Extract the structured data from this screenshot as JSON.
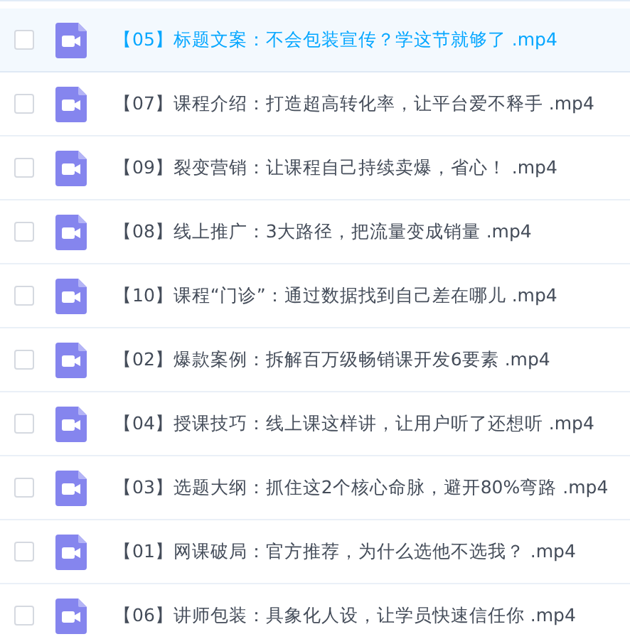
{
  "files": [
    {
      "name": "【05】标题文案：不会包装宣传？学这节就够了 .mp4",
      "selected": true,
      "checked": false
    },
    {
      "name": "【07】课程介绍：打造超高转化率，让平台爱不释手 .mp4",
      "selected": false,
      "checked": false
    },
    {
      "name": "【09】裂变营销：让课程自己持续卖爆，省心！ .mp4",
      "selected": false,
      "checked": false
    },
    {
      "name": "【08】线上推广：3大路径，把流量变成销量 .mp4",
      "selected": false,
      "checked": false
    },
    {
      "name": "【10】课程“门诊”：通过数据找到自己差在哪儿 .mp4",
      "selected": false,
      "checked": false
    },
    {
      "name": "【02】爆款案例：拆解百万级畅销课开发6要素 .mp4",
      "selected": false,
      "checked": false
    },
    {
      "name": "【04】授课技巧：线上课这样讲，让用户听了还想听 .mp4",
      "selected": false,
      "checked": false
    },
    {
      "name": "【03】选题大纲：抓住这2个核心命脉，避开80%弯路 .mp4",
      "selected": false,
      "checked": false
    },
    {
      "name": "【01】网课破局：官方推荐，为什么选他不选我？ .mp4",
      "selected": false,
      "checked": false
    },
    {
      "name": "【06】讲师包装：具象化人设，让学员快速信任你 .mp4",
      "selected": false,
      "checked": false
    }
  ]
}
